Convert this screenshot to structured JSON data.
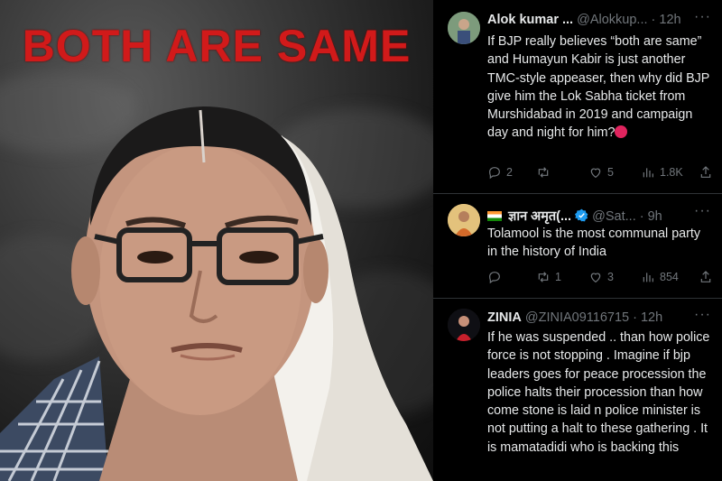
{
  "poster": {
    "headline": "BOTH ARE SAME"
  },
  "feed": {
    "tweets": [
      {
        "name": "Alok kumar ...",
        "handle": "@Alokkup...",
        "time": "· 12h",
        "text": "If BJP really believes “both are same” and Humayun Kabir is just another TMC-style appeaser, then why did BJP give him the Lok Sabha ticket from Murshidabad in 2019 and campaign day and night for him?",
        "emoji": "angry-face-icon",
        "replies": "2",
        "reposts": "",
        "likes": "5",
        "views": "1.8K"
      },
      {
        "name": "ज्ञान अमृत(...",
        "handle": "@Sat...",
        "time": "· 9h",
        "text": "Tolamool is the most communal party in the history of India",
        "replies": "",
        "reposts": "1",
        "likes": "3",
        "views": "854"
      },
      {
        "name": "ZINIA",
        "handle": "@ZINIA09116715",
        "time": "· 12h",
        "text": "If he was suspended .. than how police force is not stopping . Imagine if bjp leaders goes for peace procession the police halts their procession than how come stone is laid n police minister is not putting a halt to these gathering . It is mamatadidi who is backing this"
      }
    ]
  },
  "colors": {
    "headline": "#d11a1a",
    "feed_bg": "#000000",
    "text": "#e7e9ea",
    "muted": "#71767b",
    "divider": "#2f3336",
    "verified": "#1d9bf0"
  }
}
